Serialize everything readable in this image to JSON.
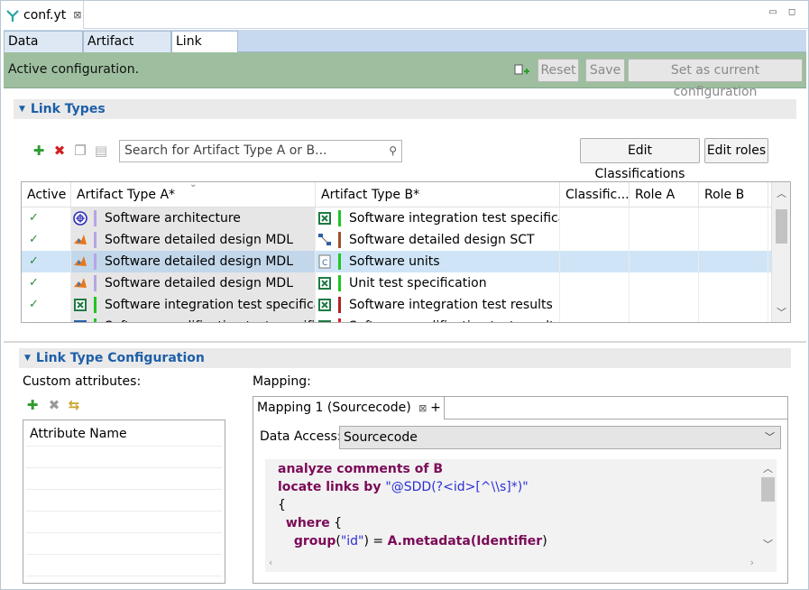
{
  "editor": {
    "tab_title": "conf.yt",
    "tab_close": "⊠"
  },
  "window": {
    "minimize": "▭",
    "maximize": "◻"
  },
  "subtabs": [
    "Data Access",
    "Artifact Types",
    "Link Types"
  ],
  "status": {
    "message": "Active configuration.",
    "reset_label": "Reset",
    "save_label": "Save",
    "set_current_label": "Set as current configuration"
  },
  "link_types": {
    "section_title": "Link Types",
    "search_placeholder": "Search for Artifact Type A or B...",
    "edit_classifications_label": "Edit Classifications",
    "edit_roles_label": "Edit roles",
    "columns": [
      "Active",
      "Artifact Type A*",
      "Artifact Type B*",
      "Classific...",
      "Role A",
      "Role B"
    ],
    "rows": [
      {
        "active": "✓",
        "a_icon": "architecture-icon",
        "a_bar": "#b6a5e6",
        "a": "Software architecture",
        "b_icon": "excel-icon",
        "b_bar": "#22c422",
        "b": "Software integration test specificat",
        "selected": false
      },
      {
        "active": "✓",
        "a_icon": "matlab-icon",
        "a_bar": "#b6a5e6",
        "a": "Software detailed design MDL",
        "b_icon": "sct-icon",
        "b_bar": "#a0522d",
        "b": "Software detailed design SCT",
        "selected": false
      },
      {
        "active": "✓",
        "a_icon": "matlab-icon",
        "a_bar": "#b6a5e6",
        "a": "Software detailed design MDL",
        "b_icon": "c-file-icon",
        "b_bar": "#22c422",
        "b": "Software units",
        "selected": true
      },
      {
        "active": "✓",
        "a_icon": "matlab-icon",
        "a_bar": "#b6a5e6",
        "a": "Software detailed design MDL",
        "b_icon": "excel-icon",
        "b_bar": "#22c422",
        "b": "Unit test specification",
        "selected": false
      },
      {
        "active": "✓",
        "a_icon": "excel-icon",
        "a_bar": "#22c422",
        "a": "Software integration test specificat",
        "b_icon": "excel-icon",
        "b_bar": "#b22222",
        "b": "Software integration test results",
        "selected": false
      },
      {
        "active": "✓",
        "a_icon": "doc-icon",
        "a_bar": "#22c422",
        "a": "Software qualification test specifi",
        "b_icon": "excel-icon",
        "b_bar": "#d62020",
        "b": "Software qualification test results",
        "selected": false
      }
    ]
  },
  "link_type_config": {
    "section_title": "Link Type Configuration",
    "custom_attributes_label": "Custom attributes:",
    "attribute_name_header": "Attribute Name",
    "mapping_label": "Mapping:",
    "mapping_tab_label": "Mapping 1 (Sourcecode)",
    "mapping_tab_close": "⊠",
    "add_mapping_label": "+",
    "data_access_label": "Data Access:",
    "data_access_value": "Sourcecode",
    "code_lines": [
      [
        {
          "t": "analyze comments of B",
          "c": "kw"
        }
      ],
      [
        {
          "t": "locate links by ",
          "c": "kw"
        },
        {
          "t": "\"@SDD(?<id>[^\\\\s]*)\"",
          "c": "str"
        }
      ],
      [
        {
          "t": "{",
          "c": ""
        }
      ],
      [
        {
          "t": "  ",
          "c": ""
        },
        {
          "t": "where",
          "c": "kw"
        },
        {
          "t": " {",
          "c": ""
        }
      ],
      [
        {
          "t": "    ",
          "c": ""
        },
        {
          "t": "group",
          "c": "kw"
        },
        {
          "t": "(",
          "c": ""
        },
        {
          "t": "\"id\"",
          "c": "str"
        },
        {
          "t": ") = ",
          "c": ""
        },
        {
          "t": "A.metadata(Identifier",
          "c": "kw"
        },
        {
          "t": ")",
          "c": ""
        }
      ]
    ]
  },
  "colors": {
    "accent": "#1d5fa8",
    "status_bar": "#9dbf9f",
    "selection": "#cfe5f7",
    "check": "#2d8a3d"
  }
}
